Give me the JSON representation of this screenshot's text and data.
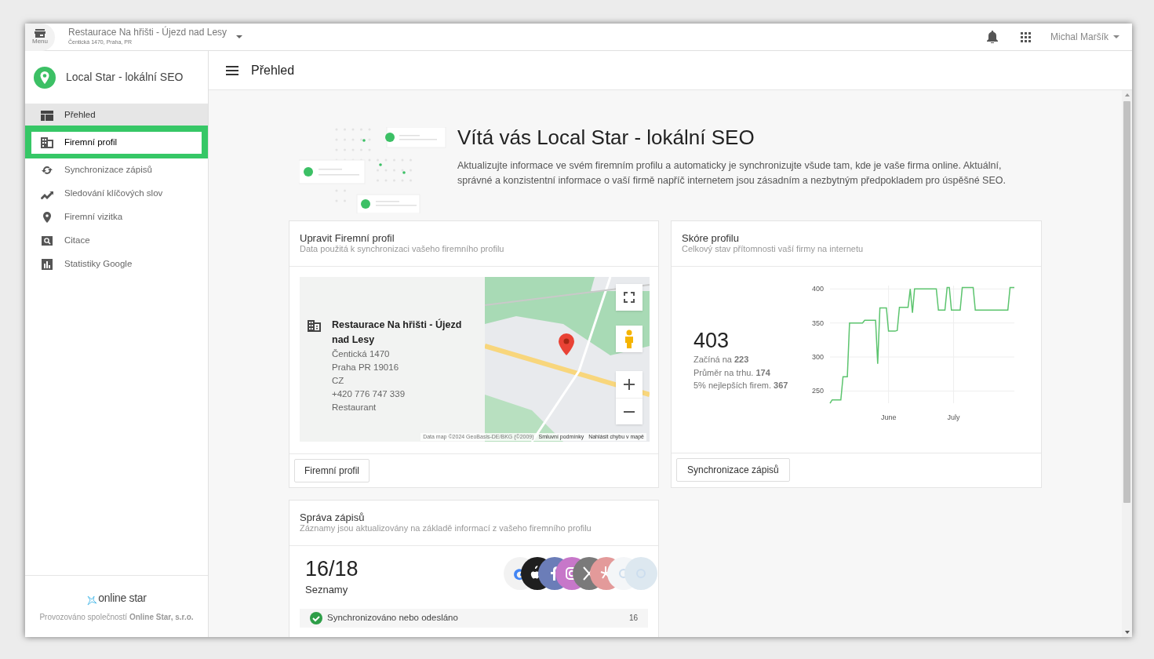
{
  "topbar": {
    "menu_label": "Menu",
    "business_name": "Restaurace Na hřišti - Újezd nad Lesy",
    "business_address": "Čentická 1470, Praha, PR",
    "user_name": "Michal Maršík"
  },
  "sidebar": {
    "app_title": "Local Star - lokální SEO",
    "items": [
      {
        "label": "Přehled",
        "kind": "dashboard",
        "selected": true,
        "highlighted": false
      },
      {
        "label": "Firemní profil",
        "kind": "building",
        "selected": false,
        "highlighted": true
      },
      {
        "label": "Synchronizace zápisů",
        "kind": "sync",
        "selected": false,
        "highlighted": false
      },
      {
        "label": "Sledování klíčových slov",
        "kind": "trend",
        "selected": false,
        "highlighted": false
      },
      {
        "label": "Firemní vizitka",
        "kind": "pin",
        "selected": false,
        "highlighted": false
      },
      {
        "label": "Citace",
        "kind": "search",
        "selected": false,
        "highlighted": false
      },
      {
        "label": "Statistiky Google",
        "kind": "stats",
        "selected": false,
        "highlighted": false
      }
    ],
    "footer_logo": "online star",
    "footer_text": "Provozováno společností **Online Star, s.r.o.**"
  },
  "header": {
    "title": "Přehled"
  },
  "welcome": {
    "title": "Vítá vás Local Star - lokální SEO",
    "text": "Aktualizujte informace ve svém firemním profilu a automaticky je synchronizujte všude tam, kde je vaše firma online. Aktuální, správné a konzistentní informace o vaší firmě napříč internetem jsou zásadním a nezbytným předpokladem pro úspěšné SEO."
  },
  "profile_card": {
    "title": "Upravit Firemní profil",
    "subtitle": "Data použitá k synchronizaci vašeho firemního profilu",
    "map": {
      "name": "Restaurace Na hřišti - Újezd nad Lesy",
      "lines": [
        "Čentická 1470",
        "Praha PR 19016",
        "CZ",
        "+420 776 747 339",
        "Restaurant"
      ],
      "attribution": [
        "Data map ©2024 GeoBasis-DE/BKG (©2009)",
        "Smluvní podmínky",
        "Nahlásit chybu v mapě"
      ]
    },
    "button": "Firemní profil"
  },
  "score_card": {
    "title": "Skóre profilu",
    "subtitle": "Celkový stav přítomnosti vaší firmy na internetu",
    "score": "403",
    "stats": [
      "Začíná na **223**",
      "Průměr na trhu. **174**",
      "5% nejlepších firem. **367**"
    ],
    "chart_data": {
      "type": "line",
      "categories": [
        null,
        null,
        null,
        null,
        null,
        null,
        null,
        null,
        null,
        null,
        null,
        null,
        null,
        null,
        null,
        null,
        null,
        null,
        null,
        null,
        null,
        null,
        null,
        null,
        null,
        null,
        null,
        "June",
        null,
        null,
        null,
        null,
        null,
        null,
        null,
        null,
        null,
        null,
        null,
        null,
        null,
        null,
        null,
        null,
        null,
        null,
        null,
        null,
        null,
        null,
        null,
        null,
        null,
        null,
        null,
        null,
        null,
        "July",
        null,
        null,
        null,
        null,
        null,
        null,
        null,
        null,
        null,
        null,
        null,
        null,
        null,
        null,
        null,
        null,
        null,
        null,
        null,
        null,
        null,
        null,
        null,
        null,
        null,
        null,
        null,
        null
      ],
      "series": [
        {
          "color": "#5cc46e",
          "values": [
            232,
            237,
            237,
            237,
            237,
            237,
            271,
            271,
            271,
            350,
            350,
            350,
            350,
            350,
            350,
            350,
            354,
            354,
            354,
            354,
            354,
            354,
            290,
            372,
            372,
            372,
            372,
            338,
            338,
            338,
            338,
            339,
            373,
            373,
            373,
            373,
            373,
            400,
            365,
            400,
            400,
            400,
            400,
            400,
            400,
            400,
            400,
            400,
            400,
            400,
            369,
            369,
            369,
            369,
            402,
            402,
            369,
            369,
            369,
            369,
            369,
            402,
            402,
            402,
            402,
            402,
            402,
            369,
            369,
            369,
            369,
            369,
            369,
            369,
            369,
            369,
            369,
            369,
            369,
            369,
            369,
            369,
            369,
            402,
            402,
            402
          ]
        }
      ],
      "grid": true,
      "ylim": [
        232,
        405
      ],
      "yticks": [
        250,
        300,
        350,
        400
      ]
    },
    "button": "Synchronizace zápisů"
  },
  "listings_card": {
    "title": "Správa zápisů",
    "subtitle": "Záznamy jsou aktualizovány na základě informací z vašeho firemního profilu",
    "count": "16/18",
    "count_label": "Seznamy",
    "services": [
      {
        "kind": "google",
        "color": "#f2f2f2"
      },
      {
        "kind": "apple",
        "color": "#1f1f1f"
      },
      {
        "kind": "facebook",
        "color": "#6b7db8"
      },
      {
        "kind": "instagram",
        "color": "#c777c9"
      },
      {
        "kind": "x",
        "color": "#7a7a7a"
      },
      {
        "kind": "yelp",
        "color": "#e39a9a"
      },
      {
        "kind": "generic",
        "color": "#f4f6f8"
      },
      {
        "kind": "generic",
        "color": "#dde8f0"
      }
    ],
    "rows": [
      {
        "label": "Synchronizováno nebo odesláno",
        "count": "16",
        "checked": true
      }
    ]
  }
}
